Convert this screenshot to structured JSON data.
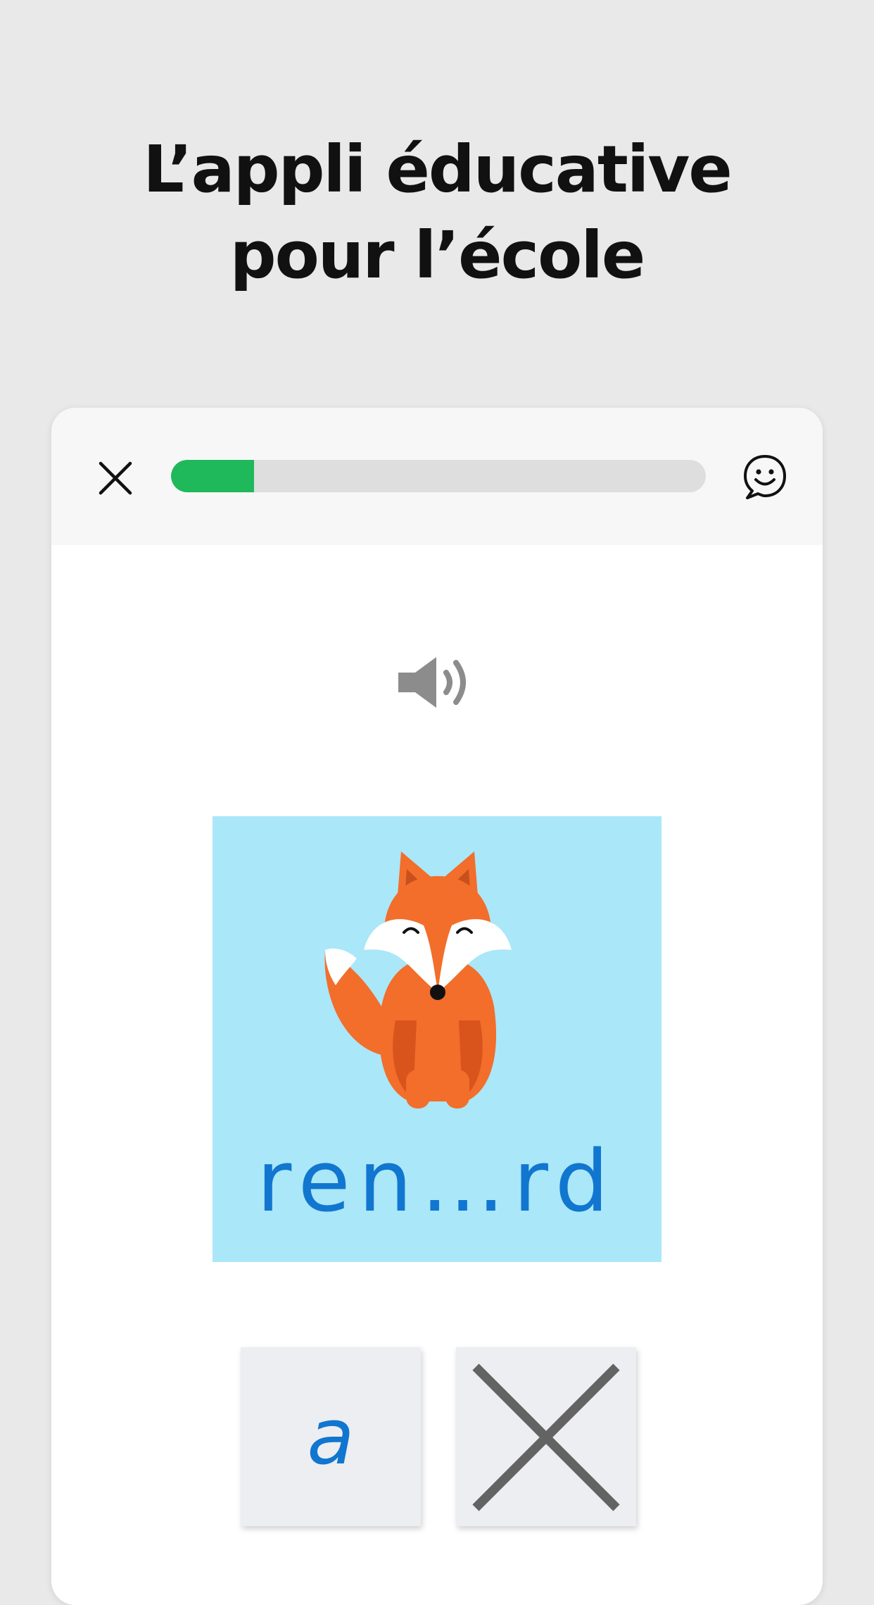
{
  "headline": {
    "line1": "L’appli éducative",
    "line2": "pour  l’école"
  },
  "exercise": {
    "progress_fraction": 0.155,
    "word_prompt": "ren…rd",
    "options": [
      {
        "label": "a"
      },
      {
        "label": ""
      }
    ]
  },
  "icons": {
    "close": "close-icon",
    "feedback": "smiley-chat-icon",
    "audio": "speaker-icon",
    "picture": "fox-illustration",
    "empty_option": "cross-icon"
  },
  "colors": {
    "progress": "#1fb85a",
    "word": "#1176cf",
    "picture_bg": "#aae7f8",
    "fox_orange": "#f26e2a"
  }
}
